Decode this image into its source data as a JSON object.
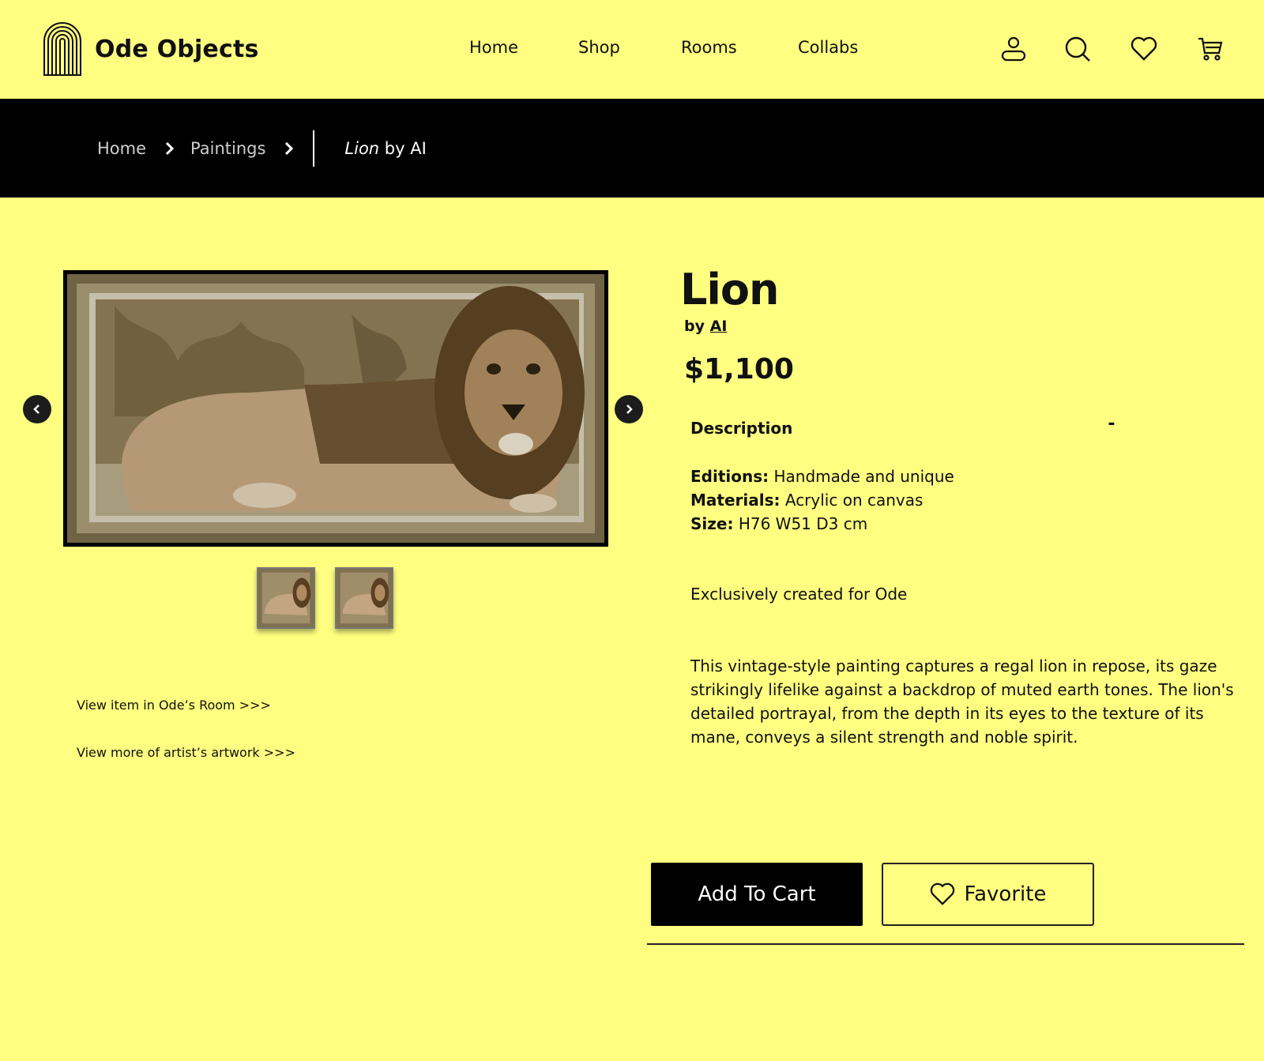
{
  "brand": {
    "name": "Ode Objects"
  },
  "nav": {
    "items": [
      "Home",
      "Shop",
      "Rooms",
      "Collabs"
    ]
  },
  "header_icons": [
    "account-icon",
    "search-icon",
    "heart-icon",
    "cart-icon"
  ],
  "breadcrumb": {
    "items": [
      "Home",
      "Paintings"
    ],
    "current_title": "Lion",
    "current_suffix": " by AI"
  },
  "product": {
    "title": "Lion",
    "by_prefix": "by ",
    "artist": "AI",
    "price": "$1,100",
    "description_heading": "Description",
    "description_toggle": "-",
    "specs": [
      {
        "label": "Editions:",
        "value": " Handmade and unique"
      },
      {
        "label": "Materials:",
        "value": " Acrylic on canvas"
      },
      {
        "label": "Size:",
        "value": " H76 W51 D3 cm"
      }
    ],
    "exclusive": "Exclusively created for Ode",
    "blurb": "This vintage-style painting captures a regal lion in repose, its gaze strikingly lifelike against a backdrop of muted earth tones. The lion's detailed portrayal, from the depth in its eyes to the texture of its mane, conveys a silent strength and noble spirit."
  },
  "gallery": {
    "prev_icon": "chevron-left-icon",
    "next_icon": "chevron-right-icon",
    "thumbnail_count": 2
  },
  "links": {
    "room": "View item in Ode’s Room >>>",
    "artist": "View more of artist’s artwork >>>"
  },
  "actions": {
    "add_to_cart": "Add To Cart",
    "favorite": "Favorite"
  },
  "colors": {
    "background": "#fefe80",
    "bar": "#000000",
    "text": "#111111"
  }
}
